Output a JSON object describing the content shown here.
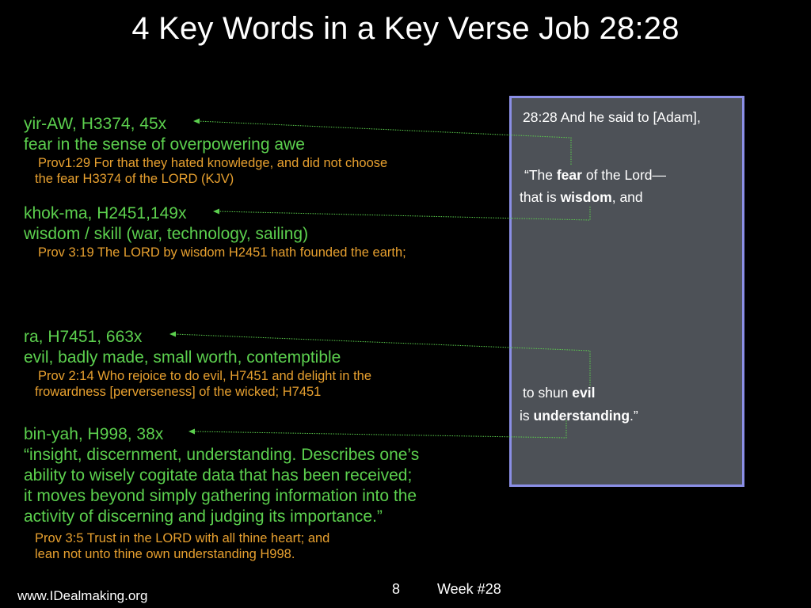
{
  "slide": {
    "title": "4 Key Words in a Key Verse Job 28:28"
  },
  "words": [
    {
      "head": "yir-AW, H3374, 45x",
      "definition": [
        "fear in the sense of overpowering awe"
      ],
      "reference": [
        "Prov1:29  For that they hated knowledge, and did not choose",
        "the fear H3374 of the LORD (KJV)"
      ]
    },
    {
      "head": "khok-ma, H2451,149x",
      "definition": [
        "wisdom / skill (war, technology, sailing)"
      ],
      "reference": [
        "Prov 3:19 The LORD by wisdom H2451 hath founded the earth;"
      ]
    },
    {
      "head": "ra, H7451, 663x",
      "definition": [
        "evil, badly made, small worth, contemptible"
      ],
      "reference": [
        "Prov 2:14 Who rejoice to do evil, H7451 and delight in the",
        "frowardness [perverseness] of the wicked; H7451"
      ]
    },
    {
      "head": "bin-yah, H998, 38x",
      "definition": [
        "“insight, discernment, understanding. Describes one’s",
        "ability to wisely cogitate data that has been received;",
        "it moves beyond simply gathering information into the",
        "activity of discerning and judging its importance.”"
      ],
      "reference": [
        "Prov 3:5 Trust in the LORD with all thine heart; and",
        "lean not unto thine own understanding H998."
      ]
    }
  ],
  "verse": {
    "line1": "28:28 And he said to [Adam],",
    "line2_pre": "“The ",
    "line2_bold": "fear",
    "line2_post": " of the Lord—",
    "line3_pre": "that is ",
    "line3_bold": "wisdom",
    "line3_post": ", and",
    "line4_pre": "to shun ",
    "line4_bold": "evil",
    "line5_pre": "is ",
    "line5_bold": "understanding",
    "line5_post": ".”"
  },
  "footer": {
    "website": "www.IDealmaking.org",
    "page_number": "8",
    "week": "Week #28"
  },
  "colors": {
    "background": "#000000",
    "green_text": "#5cd04e",
    "orange_text": "#e7a02f",
    "verse_box": "#4d5157",
    "verse_border": "#8b8fe6"
  }
}
